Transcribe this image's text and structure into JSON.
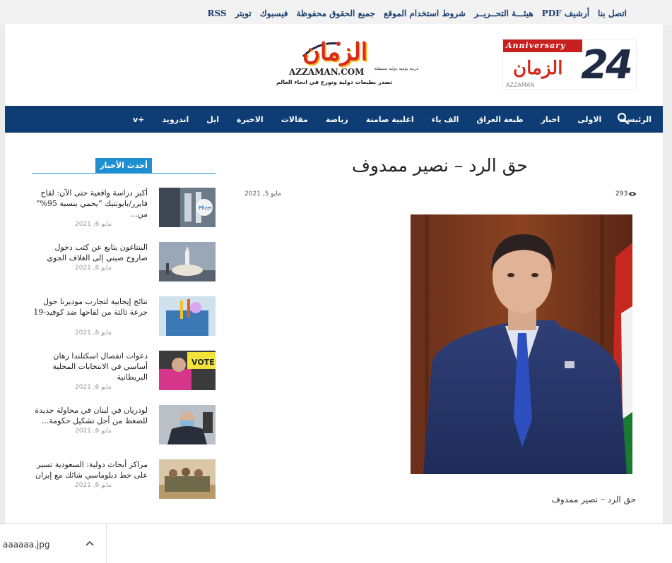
{
  "top_links": [
    "اتصل بنا",
    "أرشيف PDF",
    "هيئـــة التحــريــر",
    "شروط استخدام الموقع",
    "جميع الحقوق محفوظة",
    "فيسبوك",
    "تويتر",
    "RSS"
  ],
  "logo": {
    "title": "الزمان",
    "subtitle": "عربية يومية دولية مستقلة",
    "english": "AZZAMAN.COM",
    "tagline": "تصدر بطبعات دولية وتوزع في انحاء العالم"
  },
  "banner": {
    "ribbon": "Anniversary",
    "number": "24",
    "word": "الزمان",
    "footer": "AZZAMAN"
  },
  "nav": [
    "الرئيسية",
    "الاولى",
    "اخبار",
    "طبعة العراق",
    "الف ياء",
    "اغلبية صامتة",
    "رياضة",
    "مقالات",
    "الاخيرة",
    "ايل",
    "اندرويد",
    "+v"
  ],
  "sidebar": {
    "heading": "أحدث الأخبار",
    "items": [
      {
        "title": "أكبر دراسة واقعية حتى الآن: لقاح فايزر/بايونتيك “يحمي بنسبة 95%” من...",
        "date": "مايو 6, 2021",
        "thumb": "pfizer"
      },
      {
        "title": "البنتاغون يتابع عن كثب دخول صاروخ صيني إلى الغلاف الجوي",
        "date": "مايو 6, 2021",
        "thumb": "rocket"
      },
      {
        "title": "نتائج إيجابية لتجارب موديرنا حول جرعة ثالثة من لقاحها ضد كوفيد-19",
        "date": "مايو 6, 2021",
        "thumb": "lab"
      },
      {
        "title": "دعوات انفصال اسكتلندا رهان أساسي في الانتخابات المحلية البريطانية",
        "date": "مايو 6, 2021",
        "thumb": "votes"
      },
      {
        "title": "لودريان في لبنان في محاولة جديدة للضغط من أجل تشكيل حكومة...",
        "date": "مايو 6, 2021",
        "thumb": "minister"
      },
      {
        "title": "مراكز أبحاث دولية: السعودية تسير على خط دبلوماسي شائك مع إيران",
        "date": "مايو 6, 2021",
        "thumb": "soldiers"
      }
    ]
  },
  "thumb_text": {
    "pfizer": "Pfizer",
    "votes": "VOTES"
  },
  "article": {
    "title": "حق الرد – نصير ممدوف",
    "date": "مايو 5, 2021",
    "views": "293",
    "caption": "حق الرد – نصير ممدوف"
  },
  "download": {
    "filename": "aaaaaa.jpg"
  }
}
